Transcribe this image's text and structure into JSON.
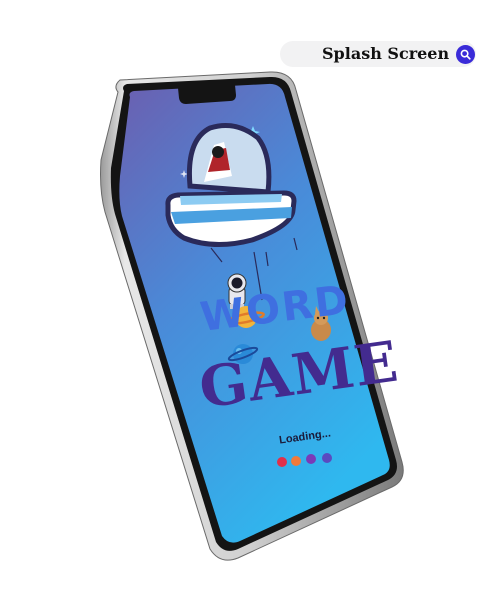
{
  "header": {
    "title": "Splash Screen",
    "search_icon": "search-icon",
    "accent": "#3a2bd8"
  },
  "splash": {
    "word_title": "WORD",
    "game_title": "GAME",
    "loading_text": "Loading...",
    "loading_dots": [
      {
        "name": "loading-dot-red",
        "color": "#e0304a"
      },
      {
        "name": "loading-dot-orange",
        "color": "#f07a3a"
      },
      {
        "name": "loading-dot-purple",
        "color": "#7a3ab8"
      },
      {
        "name": "loading-dot-violet",
        "color": "#5a4ac0"
      }
    ],
    "screen_gradient": [
      "#6b5fb0",
      "#2fb8ef"
    ]
  }
}
